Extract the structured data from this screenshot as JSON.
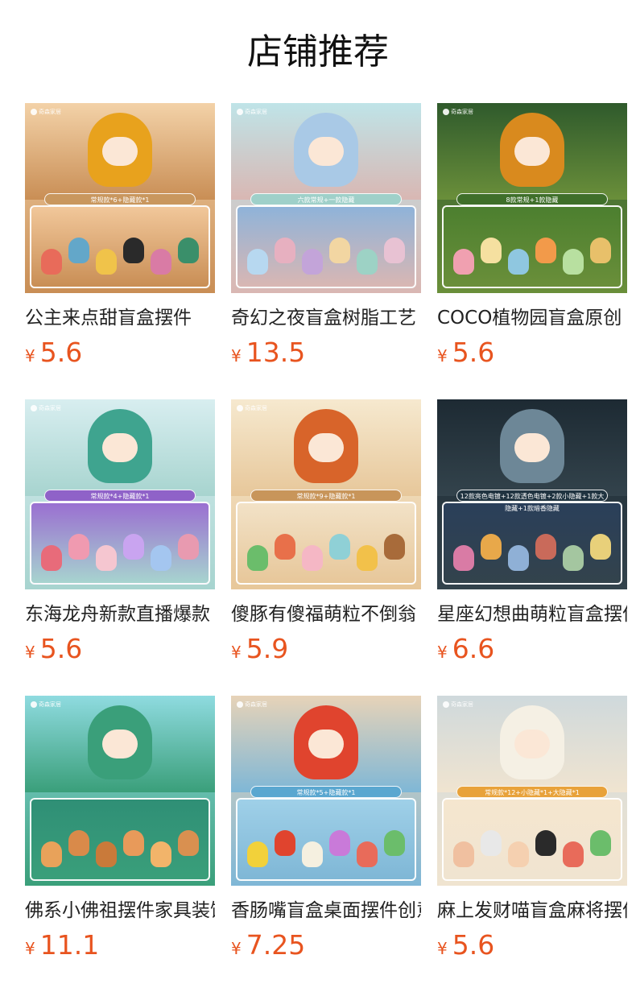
{
  "section": {
    "title": "店铺推荐"
  },
  "products": [
    {
      "name": "公主来点甜盲盒摆件",
      "currency": "¥",
      "price": "5.6",
      "banner": "常规款*6+隐藏款*1",
      "logo": "奇森家居",
      "colors": {
        "scene_top": "#f3d2a8",
        "scene_bottom": "#c98e55",
        "hero": "#e8a21d",
        "panel": "#f1c79a",
        "banner_bg": "#c9975e",
        "fig": [
          "#e86b5a",
          "#63a7c9",
          "#f0c34a",
          "#2a2a2a",
          "#d97ba5",
          "#3a8f6a"
        ]
      }
    },
    {
      "name": "奇幻之夜盲盒树脂工艺",
      "currency": "¥",
      "price": "13.5",
      "banner": "六款常规+一款隐藏",
      "logo": "奇森家居",
      "colors": {
        "scene_top": "#bfe4e8",
        "scene_bottom": "#d9b7b3",
        "hero": "#a9c9e6",
        "panel": "#8fb3d9",
        "banner_bg": "#9fd0c9",
        "fig": [
          "#b7d8f0",
          "#e7b0c0",
          "#c3a4d9",
          "#f2d6a2",
          "#9dd2c5",
          "#e8c2d3"
        ]
      }
    },
    {
      "name": "COCO植物园盲盒原创",
      "currency": "¥",
      "price": "5.6",
      "banner": "8款常规+1款隐藏",
      "logo": "奇森家居",
      "colors": {
        "scene_top": "#2f5a2c",
        "scene_bottom": "#6a8f3a",
        "hero": "#d98a1e",
        "panel": "#4c7f2f",
        "banner_bg": "#3f6f2a",
        "fig": [
          "#f0a0b0",
          "#f5e0a0",
          "#8fc7e0",
          "#f29a4a",
          "#b8e0a0",
          "#e8c06a"
        ]
      }
    },
    {
      "name": "东海龙舟新款直播爆款",
      "currency": "¥",
      "price": "5.6",
      "banner": "常规款*4+隐藏款*1",
      "logo": "奇森家居",
      "colors": {
        "scene_top": "#d8eef0",
        "scene_bottom": "#a7d4cf",
        "hero": "#3fa48f",
        "panel": "#9a6fd1",
        "banner_bg": "#8f62c8",
        "fig": [
          "#e86b7a",
          "#f09ab0",
          "#f5c6d0",
          "#c9a4f0",
          "#a4c6f0",
          "#e89ab0"
        ]
      }
    },
    {
      "name": "傻豚有傻福萌粒不倒翁",
      "currency": "¥",
      "price": "5.9",
      "banner": "常规款*9+隐藏款*1",
      "logo": "奇森家居",
      "colors": {
        "scene_top": "#f6e9cf",
        "scene_bottom": "#e7c79a",
        "hero": "#d8642a",
        "panel": "#f2e2c7",
        "banner_bg": "#c8955a",
        "fig": [
          "#6bbd6b",
          "#e8704a",
          "#f5b7c5",
          "#8fd0d6",
          "#f2c14a",
          "#a86b3a"
        ]
      }
    },
    {
      "name": "星座幻想曲萌粒盲盒摆件",
      "currency": "¥",
      "price": "6.6",
      "banner": "12款亮色电镀+12款透色电镀+2款小隐藏+1款大隐藏+1款暗香隐藏",
      "logo": "",
      "colors": {
        "scene_top": "#1d2a33",
        "scene_bottom": "#33434c",
        "hero": "#6d8797",
        "panel": "#2a3f5a",
        "banner_bg": "#1f3340",
        "fig": [
          "#d97ba5",
          "#e8a84a",
          "#8fb0d6",
          "#c96a5a",
          "#a4c6a0",
          "#e8d07a"
        ]
      }
    },
    {
      "name": "佛系小佛祖摆件家具装饰",
      "currency": "¥",
      "price": "11.1",
      "banner": "",
      "logo": "奇森家居",
      "colors": {
        "scene_top": "#8fdbe0",
        "scene_bottom": "#3a9f7a",
        "hero": "#3a9f7a",
        "panel": "#2f8f76",
        "banner_bg": "#2f8f76",
        "fig": [
          "#e8a25a",
          "#d98a4a",
          "#c97a3a",
          "#e89a5a",
          "#f2b46a",
          "#d99050"
        ]
      }
    },
    {
      "name": "香肠嘴盲盒桌面摆件创意",
      "currency": "¥",
      "price": "7.25",
      "banner": "常规款*5+隐藏款*1",
      "logo": "奇森家居",
      "colors": {
        "scene_top": "#e7d3b8",
        "scene_bottom": "#7fb7d6",
        "hero": "#e0442e",
        "panel": "#9fd0e8",
        "banner_bg": "#5aa7d0",
        "fig": [
          "#f2d13a",
          "#e0442e",
          "#f5f0e0",
          "#c97ad9",
          "#e86b5a",
          "#6bbd6b"
        ]
      }
    },
    {
      "name": "麻上发财喵盲盒麻将摆件",
      "currency": "¥",
      "price": "5.6",
      "banner": "常规款*12+小隐藏*1+大隐藏*1",
      "logo": "奇森家居",
      "colors": {
        "scene_top": "#cfd9dc",
        "scene_bottom": "#f0e4d0",
        "hero": "#f5f0e4",
        "panel": "#f5e6cf",
        "banner_bg": "#e8a23a",
        "fig": [
          "#f0c0a0",
          "#e8e8e8",
          "#f5d0b0",
          "#2a2a2a",
          "#e86b5a",
          "#6bbd6b"
        ]
      }
    }
  ]
}
